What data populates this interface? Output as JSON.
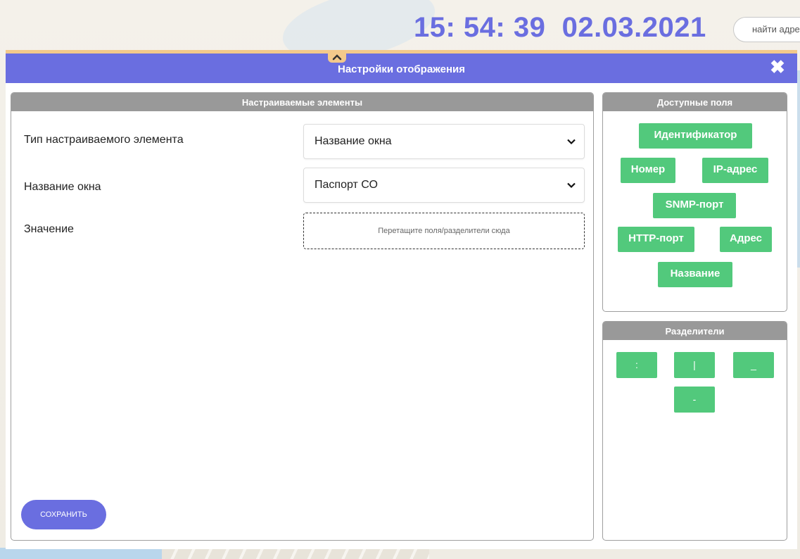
{
  "topbar": {
    "time": "15: 54: 39",
    "date": "02.03.2021",
    "search_placeholder": "найти адрес"
  },
  "dialog": {
    "title": "Настройки отображения",
    "close_icon": "close-icon",
    "collapse_icon": "chevron-up-icon"
  },
  "customize_panel": {
    "title": "Настраиваемые элементы",
    "rows": [
      {
        "label": "Тип настраиваемого элемента",
        "value": "Название окна"
      },
      {
        "label": "Название окна",
        "value": "Паспорт СО"
      },
      {
        "label": "Значение",
        "placeholder": "Перетащите поля/разделители сюда"
      }
    ],
    "save_label": "СОХРАНИТЬ"
  },
  "fields_panel": {
    "title": "Доступные поля",
    "fields": [
      "Идентификатор",
      "Номер",
      "IP-адрес",
      "SNMP-порт",
      "HTTP-порт",
      "Адрес",
      "Название"
    ]
  },
  "separators_panel": {
    "title": "Разделители",
    "items": [
      ":",
      "|",
      "_",
      "-"
    ]
  },
  "colors": {
    "accent": "#6a6ee0",
    "chip": "#52c97c",
    "panel_header": "#999999",
    "collapse_tab": "#f3c98b"
  }
}
